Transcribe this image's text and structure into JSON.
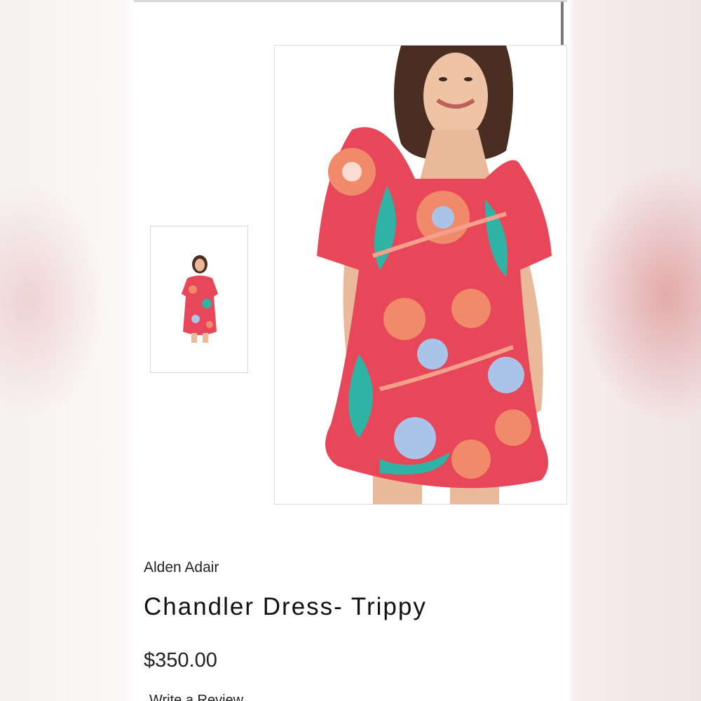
{
  "product": {
    "brand": "Alden Adair",
    "title": "Chandler Dress- Trippy",
    "price": "$350.00",
    "review_link": "Write a Review"
  },
  "gallery": {
    "thumbnail_count": 1,
    "selected_index": 0
  },
  "colors": {
    "dress_red": "#e8475a",
    "dress_coral": "#f08a6a",
    "dress_teal": "#2fb3a4",
    "dress_lightblue": "#a9c4e8",
    "hair": "#4a2e22",
    "skin": "#e9b99a"
  }
}
